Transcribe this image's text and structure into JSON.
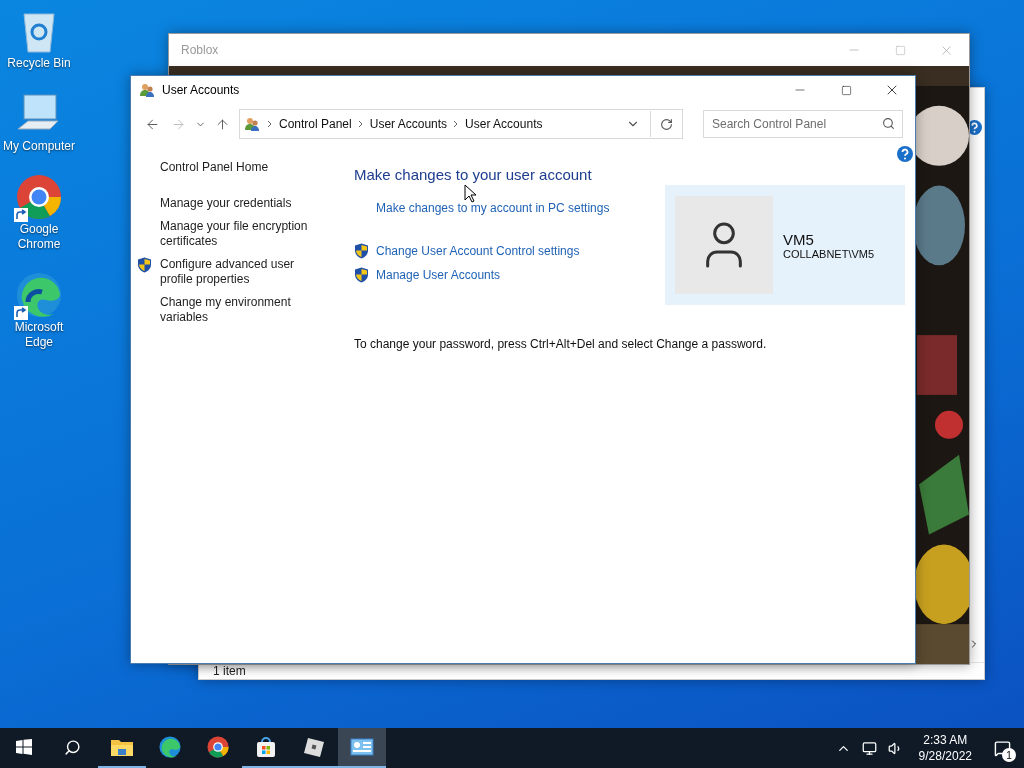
{
  "desktop_icons": [
    {
      "label": "Recycle Bin",
      "kind": "recycle",
      "shortcut": false
    },
    {
      "label": "My Computer",
      "kind": "computer",
      "shortcut": false
    },
    {
      "label": "Google Chrome",
      "kind": "chrome",
      "shortcut": true
    },
    {
      "label": "Microsoft Edge",
      "kind": "edge",
      "shortcut": true
    }
  ],
  "roblox_window": {
    "title": "Roblox"
  },
  "explorer_window": {
    "status": "1 item"
  },
  "window": {
    "title": "User Accounts",
    "address": {
      "crumbs": [
        "Control Panel",
        "User Accounts",
        "User Accounts"
      ]
    },
    "search": {
      "placeholder": "Search Control Panel"
    },
    "sidebar": {
      "items": [
        {
          "label": "Control Panel Home",
          "shield": false
        },
        {
          "label": "Manage your credentials",
          "shield": false
        },
        {
          "label": "Manage your file encryption certificates",
          "shield": false
        },
        {
          "label": "Configure advanced user profile properties",
          "shield": true
        },
        {
          "label": "Change my environment variables",
          "shield": false
        }
      ]
    },
    "main": {
      "heading": "Make changes to your user account",
      "links": [
        {
          "label": "Make changes to my account in PC settings",
          "shield": false
        },
        {
          "label": "Change User Account Control settings",
          "shield": true
        },
        {
          "label": "Manage User Accounts",
          "shield": true
        }
      ],
      "account": {
        "name": "VM5",
        "domain": "COLLABNET\\VM5"
      },
      "note": "To change your password, press Ctrl+Alt+Del and select Change a password."
    }
  },
  "taskbar": {
    "apps": [
      {
        "kind": "explorer",
        "running": true,
        "selected": false
      },
      {
        "kind": "edge",
        "running": false,
        "selected": false
      },
      {
        "kind": "chrome",
        "running": false,
        "selected": false
      },
      {
        "kind": "store",
        "running": true,
        "selected": false
      },
      {
        "kind": "roblox",
        "running": true,
        "selected": false
      },
      {
        "kind": "controlpanel",
        "running": true,
        "selected": true
      }
    ],
    "time": "2:33 AM",
    "date": "9/28/2022",
    "notifications": "1"
  }
}
